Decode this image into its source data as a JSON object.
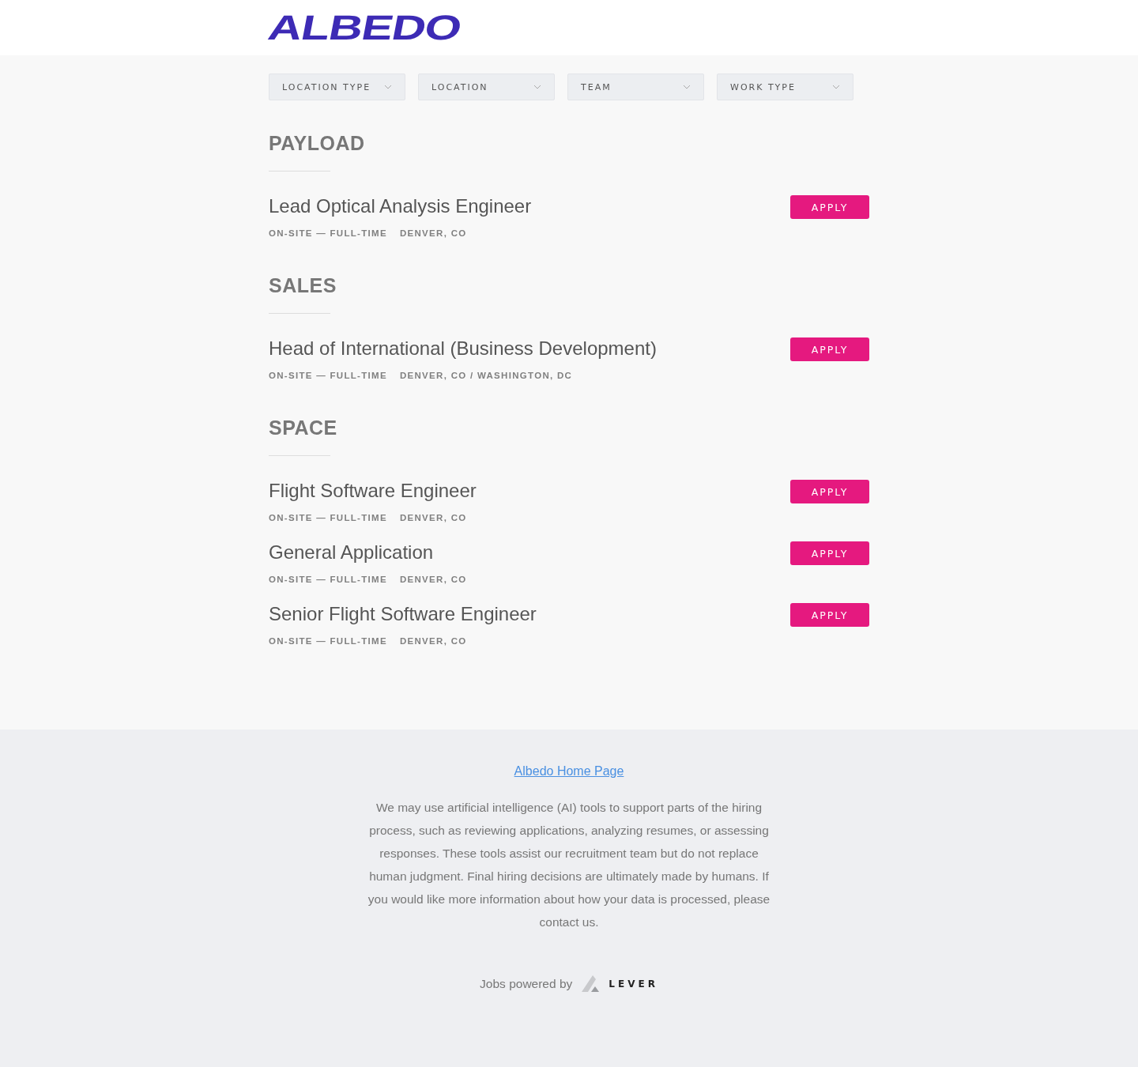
{
  "logo": "ALBEDO",
  "filters": [
    {
      "label": "LOCATION TYPE"
    },
    {
      "label": "LOCATION"
    },
    {
      "label": "TEAM"
    },
    {
      "label": "WORK TYPE"
    }
  ],
  "groups": [
    {
      "title": "PAYLOAD",
      "postings": [
        {
          "title": "Lead Optical Analysis Engineer",
          "commitment": "ON-SITE — FULL-TIME",
          "location": "DENVER, CO",
          "button": "APPLY"
        }
      ]
    },
    {
      "title": "SALES",
      "postings": [
        {
          "title": "Head of International (Business Development)",
          "commitment": "ON-SITE — FULL-TIME",
          "location": "DENVER, CO / WASHINGTON, DC",
          "button": "APPLY"
        }
      ]
    },
    {
      "title": "SPACE",
      "postings": [
        {
          "title": "Flight Software Engineer",
          "commitment": "ON-SITE — FULL-TIME",
          "location": "DENVER, CO",
          "button": "APPLY"
        },
        {
          "title": "General Application",
          "commitment": "ON-SITE — FULL-TIME",
          "location": "DENVER, CO",
          "button": "APPLY"
        },
        {
          "title": "Senior Flight Software Engineer",
          "commitment": "ON-SITE — FULL-TIME",
          "location": "DENVER, CO",
          "button": "APPLY"
        }
      ]
    }
  ],
  "footer": {
    "link": "Albedo Home Page",
    "disclaimer": "We may use artificial intelligence (AI) tools to support parts of the hiring process, such as reviewing applications, analyzing resumes, or assessing responses. These tools assist our recruitment team but do not replace human judgment. Final hiring decisions are ultimately made by humans. If you would like more information about how your data is processed, please contact us.",
    "powered_by": "Jobs powered by",
    "brand": "LEVER"
  }
}
